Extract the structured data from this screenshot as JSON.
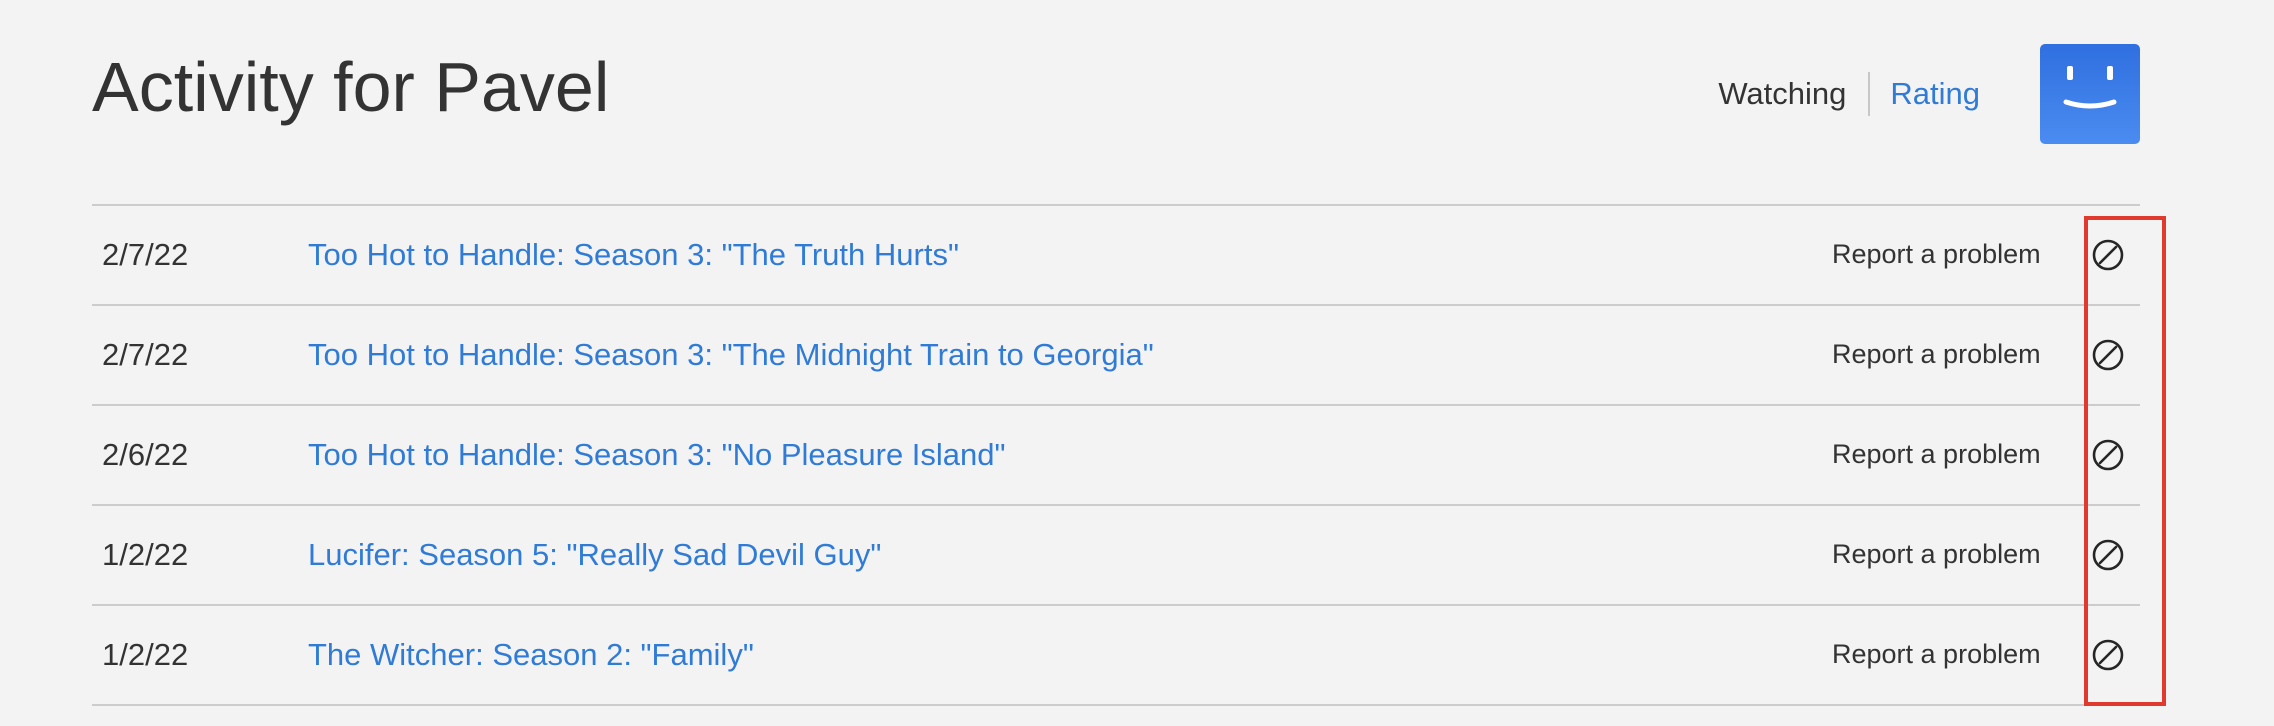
{
  "header": {
    "title": "Activity for Pavel",
    "view_toggle": {
      "watching_label": "Watching",
      "rating_label": "Rating",
      "active": "watching"
    },
    "avatar_icon": "smiley-profile-icon"
  },
  "activity": {
    "rows": [
      {
        "date": "2/7/22",
        "title": "Too Hot to Handle: Season 3: \"The Truth Hurts\"",
        "report_label": "Report a problem",
        "hide_icon": "hide-circle-slash-icon"
      },
      {
        "date": "2/7/22",
        "title": "Too Hot to Handle: Season 3: \"The Midnight Train to Georgia\"",
        "report_label": "Report a problem",
        "hide_icon": "hide-circle-slash-icon"
      },
      {
        "date": "2/6/22",
        "title": "Too Hot to Handle: Season 3: \"No Pleasure Island\"",
        "report_label": "Report a problem",
        "hide_icon": "hide-circle-slash-icon"
      },
      {
        "date": "1/2/22",
        "title": "Lucifer: Season 5: \"Really Sad Devil Guy\"",
        "report_label": "Report a problem",
        "hide_icon": "hide-circle-slash-icon"
      },
      {
        "date": "1/2/22",
        "title": "The Witcher: Season 2: \"Family\"",
        "report_label": "Report a problem",
        "hide_icon": "hide-circle-slash-icon"
      }
    ]
  },
  "colors": {
    "background": "#f3f3f3",
    "link": "#2f7bd6",
    "text": "#333333",
    "divider": "#cccccc",
    "highlight": "#e03a2f",
    "avatar": "#3a7ce6"
  }
}
